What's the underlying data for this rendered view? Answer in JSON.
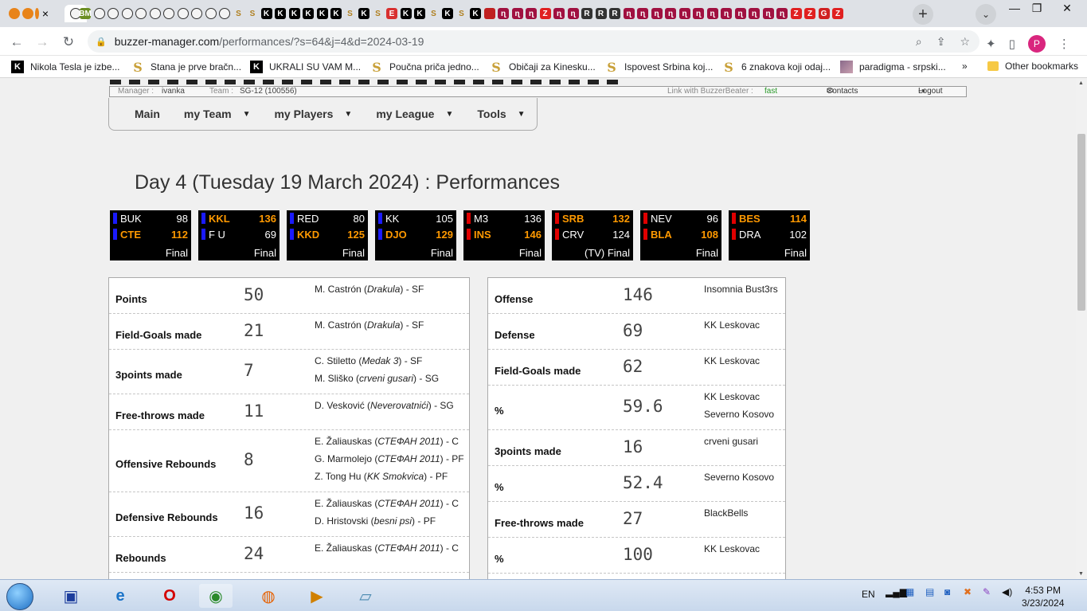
{
  "browser": {
    "tab_favicons": [
      "orange",
      "orange",
      "orange",
      "ball",
      "BM",
      "ball",
      "ball",
      "ball",
      "ball",
      "ball",
      "ball",
      "ball",
      "ball",
      "ball",
      "ball",
      "S",
      "S",
      "K",
      "K",
      "K",
      "K",
      "K",
      "K",
      "S",
      "K",
      "S",
      "E",
      "K",
      "K",
      "S",
      "K",
      "S",
      "K",
      "car",
      "n",
      "n",
      "n",
      "Z",
      "n",
      "n",
      "R",
      "R",
      "R",
      "n",
      "n",
      "n",
      "n",
      "n",
      "n",
      "n",
      "n",
      "n",
      "n",
      "n",
      "n",
      "Z",
      "Z",
      "G",
      "Z"
    ],
    "active_tab_close": "×",
    "new_tab_label": "+",
    "url_host": "buzzer-manager.com",
    "url_path": "/performances/?s=64&j=4&d=2024-03-19",
    "profile_initial": "P",
    "bookmarks": [
      {
        "icon": "K",
        "label": "Nikola Tesla je izbe..."
      },
      {
        "icon": "S",
        "label": "Stana je prve bračn..."
      },
      {
        "icon": "K",
        "label": "UKRALI SU VAM M..."
      },
      {
        "icon": "S",
        "label": "Poučna priča jedno..."
      },
      {
        "icon": "S",
        "label": "Običaji za Kinesku..."
      },
      {
        "icon": "S",
        "label": "Ispovest Srbina koj..."
      },
      {
        "icon": "S",
        "label": "6 znakova koji odaj..."
      },
      {
        "icon": "img",
        "label": "paradigma - srpski..."
      }
    ],
    "more_bookmarks": "»",
    "other_bookmarks": "Other bookmarks"
  },
  "site": {
    "manager_label": "Manager :",
    "manager_value": "ivanka",
    "team_label": "Team :",
    "team_value": "SG-12 (100556)",
    "link_label": "Link with BuzzerBeater :",
    "link_value": "fast",
    "contacts": "Contacts",
    "logout": "Logout",
    "menu": [
      "Main",
      "my Team",
      "my Players",
      "my League",
      "Tools"
    ],
    "page_title": "Day 4 (Tuesday 19 March 2024) : Performances"
  },
  "games": [
    {
      "home": "BUK",
      "home_pts": "98",
      "home_color": "#1a1aff",
      "away": "CTE",
      "away_pts": "112",
      "away_color": "#1a1aff",
      "winner": "away",
      "status": "Final"
    },
    {
      "home": "KKL",
      "home_pts": "136",
      "home_color": "#1a1aff",
      "away": "F U",
      "away_pts": "69",
      "away_color": "#1a1aff",
      "winner": "home",
      "status": "Final"
    },
    {
      "home": "RED",
      "home_pts": "80",
      "home_color": "#1a1aff",
      "away": "KKD",
      "away_pts": "125",
      "away_color": "#1a1aff",
      "winner": "away",
      "status": "Final"
    },
    {
      "home": "KK",
      "home_pts": "105",
      "home_color": "#1a1aff",
      "away": "DJO",
      "away_pts": "129",
      "away_color": "#1a1aff",
      "winner": "away",
      "status": "Final"
    },
    {
      "home": "M3",
      "home_pts": "136",
      "home_color": "#e00000",
      "away": "INS",
      "away_pts": "146",
      "away_color": "#e00000",
      "winner": "away",
      "status": "Final"
    },
    {
      "home": "SRB",
      "home_pts": "132",
      "home_color": "#e00000",
      "away": "CRV",
      "away_pts": "124",
      "away_color": "#e00000",
      "winner": "home",
      "status": "(TV) Final"
    },
    {
      "home": "NEV",
      "home_pts": "96",
      "home_color": "#e00000",
      "away": "BLA",
      "away_pts": "108",
      "away_color": "#e00000",
      "winner": "away",
      "status": "Final"
    },
    {
      "home": "BES",
      "home_pts": "114",
      "home_color": "#e00000",
      "away": "DRA",
      "away_pts": "102",
      "away_color": "#e00000",
      "winner": "home",
      "status": "Final"
    }
  ],
  "player_stats": [
    {
      "label": "Points",
      "value": "50",
      "players": [
        {
          "name": "M. Castrón",
          "team": "Drakula",
          "pos": "SF"
        }
      ]
    },
    {
      "label": "Field-Goals made",
      "value": "21",
      "players": [
        {
          "name": "M. Castrón",
          "team": "Drakula",
          "pos": "SF"
        }
      ]
    },
    {
      "label": "3points made",
      "value": "7",
      "players": [
        {
          "name": "C. Stiletto",
          "team": "Medak 3",
          "pos": "SF"
        },
        {
          "name": "M. Sliško",
          "team": "crveni gusari",
          "pos": "SG"
        }
      ]
    },
    {
      "label": "Free-throws made",
      "value": "11",
      "players": [
        {
          "name": "D. Vesković",
          "team": "Neverovatnići",
          "pos": "SG"
        }
      ]
    },
    {
      "label": "Offensive Rebounds",
      "value": "8",
      "players": [
        {
          "name": "E. Žaliauskas",
          "team": "СТЕФАН 2011",
          "pos": "C"
        },
        {
          "name": "G. Marmolejo",
          "team": "СТЕФАН 2011",
          "pos": "PF"
        },
        {
          "name": "Z. Tong Hu",
          "team": "KK Smokvica",
          "pos": "PF"
        }
      ]
    },
    {
      "label": "Defensive Rebounds",
      "value": "16",
      "players": [
        {
          "name": "E. Žaliauskas",
          "team": "СТЕФАН 2011",
          "pos": "C"
        },
        {
          "name": "D. Hristovski",
          "team": "besni psi",
          "pos": "PF"
        }
      ]
    },
    {
      "label": "Rebounds",
      "value": "24",
      "players": [
        {
          "name": "E. Žaliauskas",
          "team": "СТЕФАН 2011",
          "pos": "C"
        }
      ]
    }
  ],
  "team_stats": [
    {
      "label": "Offense",
      "value": "146",
      "teams": [
        "Insomnia Bust3rs"
      ]
    },
    {
      "label": "Defense",
      "value": "69",
      "teams": [
        "KK Leskovac"
      ]
    },
    {
      "label": "Field-Goals made",
      "value": "62",
      "teams": [
        "KK Leskovac"
      ]
    },
    {
      "label": "%",
      "value": "59.6",
      "teams": [
        "KK Leskovac",
        "Severno Kosovo"
      ]
    },
    {
      "label": "3points made",
      "value": "16",
      "teams": [
        "crveni gusari"
      ]
    },
    {
      "label": "%",
      "value": "52.4",
      "teams": [
        "Severno Kosovo"
      ]
    },
    {
      "label": "Free-throws made",
      "value": "27",
      "teams": [
        "BlackBells"
      ]
    },
    {
      "label": "%",
      "value": "100",
      "teams": [
        "KK Leskovac"
      ]
    }
  ],
  "taskbar": {
    "lang": "EN",
    "time": "4:53 PM",
    "date": "3/23/2024"
  }
}
